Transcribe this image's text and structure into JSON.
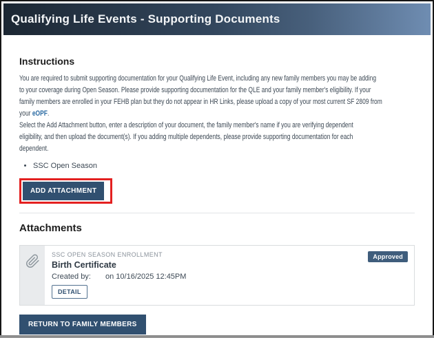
{
  "header": {
    "title": "Qualifying Life Events - Supporting Documents"
  },
  "instructions": {
    "heading": "Instructions",
    "para1_lines": [
      "You are required to submit supporting documentation for your Qualifying Life Event, including any new family members you may be adding",
      "to your coverage during Open Season. Please provide supporting documentation for the QLE and your family member's eligibility. If your",
      "family members are enrolled in your FEHB plan but they do not appear in HR Links, please upload a copy of your most current SF 2809 from"
    ],
    "para1_last_prefix": "your ",
    "eopf_link": "eOPF",
    "para1_last_suffix": ".",
    "para2_lines": [
      "Select the Add Attachment button, enter a description of your document, the family member's name if you are verifying dependent",
      "eligibility, and then upload the document(s). If you adding multiple dependents, please provide supporting documentation for each",
      "dependent."
    ],
    "bullet_items": [
      "SSC Open Season"
    ],
    "add_attachment_label": "ADD ATTACHMENT"
  },
  "attachments": {
    "heading": "Attachments",
    "items": [
      {
        "category": "SSC OPEN SEASON ENROLLMENT",
        "title": "Birth Certificate",
        "created_by_label": "Created by:",
        "created_on": "on 10/16/2025 12:45PM",
        "detail_label": "DETAIL",
        "status": "Approved",
        "icon": "paperclip-icon"
      }
    ],
    "return_button_label": "RETURN TO FAMILY MEMBERS"
  },
  "colors": {
    "header_gradient_start": "#1c2733",
    "header_gradient_end": "#6f8db2",
    "button_navy": "#315070",
    "status_badge_navy": "#3f5d7c",
    "annotation_red": "#e32020",
    "link_blue": "#2e6da4",
    "body_text": "#3c4854",
    "card_icon_panel": "#e9ebed"
  }
}
